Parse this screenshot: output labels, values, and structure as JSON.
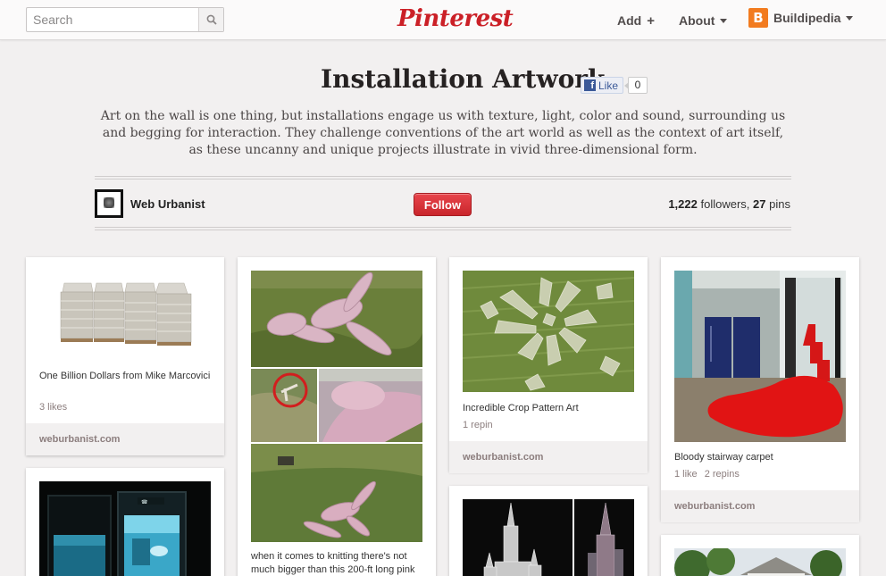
{
  "header": {
    "search_placeholder": "Search",
    "logo": "Pinterest",
    "nav": {
      "add": "Add",
      "add_symbol": "+",
      "about": "About",
      "user_initial": "B",
      "user": "Buildipedia"
    }
  },
  "board": {
    "title": "Installation Artwork",
    "like_label": "Like",
    "like_count": "0",
    "description": "Art on the wall is one thing, but installations engage us with texture, light, color and sound, surrounding us and begging for interaction. They challenge conventions of the art world as well as the context of art itself, as these uncanny and unique projects illustrate in vivid three-dimensional form.",
    "owner": "Web Urbanist",
    "follow_label": "Follow",
    "followers_count": "1,222",
    "followers_label": "followers,",
    "pins_count": "27",
    "pins_label": "pins"
  },
  "pins": [
    {
      "description": "One Billion Dollars from Mike Marcovici",
      "likes": "3 likes",
      "repins": "",
      "source": "weburbanist.com",
      "image": "money-pallets"
    },
    {
      "description": "when it comes to knitting there's not much bigger than this 200-ft long pink",
      "likes": "",
      "repins": "",
      "source": "",
      "image": "giant-pink-bunny"
    },
    {
      "description": "Incredible Crop Pattern Art",
      "likes": "",
      "repins": "1 repin",
      "source": "weburbanist.com",
      "image": "crop-circle"
    },
    {
      "description": "Bloody stairway carpet",
      "likes": "1 like",
      "repins": "2 repins",
      "source": "weburbanist.com",
      "image": "red-carpet-stairs"
    },
    {
      "description": "",
      "likes": "",
      "repins": "",
      "source": "",
      "image": "phone-booth-aquarium"
    },
    {
      "description": "",
      "likes": "",
      "repins": "",
      "source": "",
      "image": "crystal-towers"
    },
    {
      "description": "",
      "likes": "",
      "repins": "",
      "source": "",
      "image": "trees-house"
    }
  ],
  "colors": {
    "brand": "#cb2027",
    "follow_button": "#d1282e",
    "page_background": "#f2f0f0",
    "facebook": "#3b5998",
    "user_badge": "#f27b1f"
  },
  "icons": [
    "search-icon",
    "plus-icon",
    "chevron-down-icon",
    "facebook-icon"
  ]
}
